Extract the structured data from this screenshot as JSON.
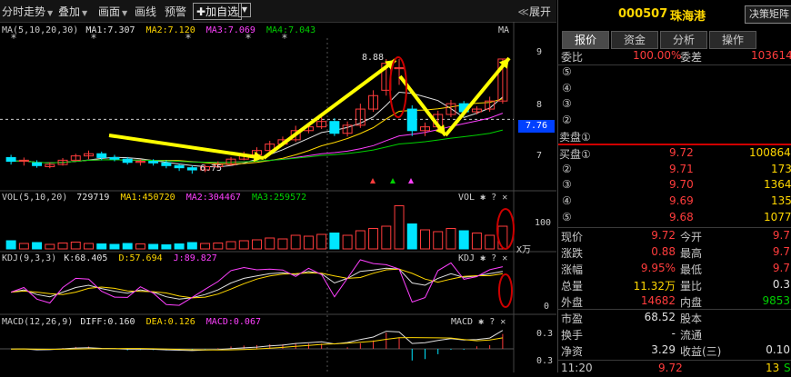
{
  "toolbar": {
    "items": [
      "分时走势",
      "叠加",
      "画面",
      "画线",
      "预警"
    ],
    "add_watch": "加自选",
    "expand": "展开"
  },
  "chart": {
    "ma_legend": {
      "label": "MA(5,10,20,30)",
      "ma1": "MA1:7.307",
      "ma2": "MA2:7.120",
      "ma3": "MA3:7.069",
      "ma4": "MA4:7.043",
      "tag": "MA"
    },
    "vol_legend": {
      "label": "VOL(5,10,20)",
      "value": "729719",
      "ma1": "MA1:450720",
      "ma2": "MA2:304467",
      "ma3": "MA3:259572",
      "tag": "VOL"
    },
    "kdj_legend": {
      "label": "KDJ(9,3,3)",
      "k": "K:68.405",
      "d": "D:57.694",
      "j": "J:89.827",
      "tag": "KDJ"
    },
    "macd_legend": {
      "label": "MACD(12,26,9)",
      "diff": "DIFF:0.160",
      "dea": "DEA:0.126",
      "macd": "MACD:0.067",
      "tag": "MACD"
    },
    "annotations": {
      "high": "8.88",
      "low": "6.75",
      "current": "7.76"
    },
    "price_axis": [
      "9",
      "8",
      "7"
    ],
    "vol_axis": [
      "100",
      "X万"
    ],
    "kdj_axis": [
      "0"
    ],
    "macd_axis": [
      "0.3",
      "0.3"
    ],
    "colors": {
      "up": "#ff3c3c",
      "down": "#00e5ff",
      "ma1": "#e0e0e0",
      "ma2": "#ffd700",
      "ma3": "#ff40ff",
      "ma4": "#00d000",
      "arrow": "#ffff00",
      "circle": "#cc0000"
    }
  },
  "chart_data": {
    "type": "candlestick",
    "price_range": [
      6.5,
      9.2
    ],
    "candles": [
      {
        "o": 7.05,
        "c": 6.98,
        "h": 7.1,
        "l": 6.92
      },
      {
        "o": 6.98,
        "c": 7.0,
        "h": 7.05,
        "l": 6.9
      },
      {
        "o": 6.95,
        "c": 6.9,
        "h": 7.0,
        "l": 6.86
      },
      {
        "o": 6.88,
        "c": 6.92,
        "h": 6.96,
        "l": 6.85
      },
      {
        "o": 6.92,
        "c": 7.0,
        "h": 7.04,
        "l": 6.9
      },
      {
        "o": 7.0,
        "c": 7.08,
        "h": 7.12,
        "l": 6.98
      },
      {
        "o": 7.08,
        "c": 7.12,
        "h": 7.18,
        "l": 7.02
      },
      {
        "o": 7.12,
        "c": 7.05,
        "h": 7.16,
        "l": 7.0
      },
      {
        "o": 7.05,
        "c": 7.02,
        "h": 7.1,
        "l": 6.98
      },
      {
        "o": 7.02,
        "c": 6.96,
        "h": 7.06,
        "l": 6.92
      },
      {
        "o": 6.96,
        "c": 6.98,
        "h": 7.02,
        "l": 6.9
      },
      {
        "o": 6.98,
        "c": 6.95,
        "h": 7.02,
        "l": 6.9
      },
      {
        "o": 6.95,
        "c": 6.9,
        "h": 7.0,
        "l": 6.85
      },
      {
        "o": 6.9,
        "c": 6.86,
        "h": 6.94,
        "l": 6.8
      },
      {
        "o": 6.86,
        "c": 6.82,
        "h": 6.9,
        "l": 6.75
      },
      {
        "o": 6.82,
        "c": 6.88,
        "h": 6.92,
        "l": 6.78
      },
      {
        "o": 6.88,
        "c": 6.92,
        "h": 6.98,
        "l": 6.85
      },
      {
        "o": 6.92,
        "c": 7.02,
        "h": 7.06,
        "l": 6.9
      },
      {
        "o": 7.02,
        "c": 7.1,
        "h": 7.16,
        "l": 7.0
      },
      {
        "o": 7.1,
        "c": 7.18,
        "h": 7.24,
        "l": 7.06
      },
      {
        "o": 7.18,
        "c": 7.3,
        "h": 7.36,
        "l": 7.15
      },
      {
        "o": 7.3,
        "c": 7.38,
        "h": 7.44,
        "l": 7.26
      },
      {
        "o": 7.38,
        "c": 7.55,
        "h": 7.64,
        "l": 7.34
      },
      {
        "o": 7.55,
        "c": 7.62,
        "h": 7.7,
        "l": 7.5
      },
      {
        "o": 7.62,
        "c": 7.72,
        "h": 7.8,
        "l": 7.58
      },
      {
        "o": 7.72,
        "c": 7.5,
        "h": 7.78,
        "l": 7.45
      },
      {
        "o": 7.5,
        "c": 7.65,
        "h": 7.72,
        "l": 7.44
      },
      {
        "o": 7.65,
        "c": 7.95,
        "h": 8.05,
        "l": 7.6
      },
      {
        "o": 7.95,
        "c": 8.2,
        "h": 8.3,
        "l": 7.9
      },
      {
        "o": 8.3,
        "c": 8.8,
        "h": 8.88,
        "l": 8.2
      },
      {
        "o": 8.7,
        "c": 8.72,
        "h": 8.88,
        "l": 8.4
      },
      {
        "o": 7.95,
        "c": 7.55,
        "h": 8.02,
        "l": 7.45
      },
      {
        "o": 7.55,
        "c": 7.62,
        "h": 7.7,
        "l": 7.45
      },
      {
        "o": 7.62,
        "c": 7.85,
        "h": 7.92,
        "l": 7.58
      },
      {
        "o": 7.85,
        "c": 8.05,
        "h": 8.12,
        "l": 7.8
      },
      {
        "o": 8.05,
        "c": 7.9,
        "h": 8.1,
        "l": 7.82
      },
      {
        "o": 7.9,
        "c": 7.95,
        "h": 8.0,
        "l": 7.85
      },
      {
        "o": 7.95,
        "c": 8.1,
        "h": 8.18,
        "l": 7.9
      },
      {
        "o": 8.1,
        "c": 8.88,
        "h": 8.88,
        "l": 8.05
      }
    ],
    "volume": [
      18,
      12,
      14,
      10,
      13,
      15,
      12,
      11,
      10,
      12,
      11,
      10,
      9,
      11,
      14,
      12,
      13,
      16,
      18,
      20,
      24,
      22,
      30,
      28,
      32,
      35,
      30,
      40,
      45,
      50,
      95,
      55,
      42,
      38,
      45,
      40,
      35,
      30,
      50
    ]
  },
  "quote": {
    "code": "000507",
    "name": "珠海港",
    "decision_button": "决策矩阵",
    "tabs": [
      "报价",
      "资金",
      "分析",
      "操作"
    ],
    "weibi_label": "委比",
    "weibi_value": "100.00%",
    "weicha_label": "委差",
    "weicha_value": "103614",
    "sell": [
      {
        "label": "⑤"
      },
      {
        "label": "④"
      },
      {
        "label": "③"
      },
      {
        "label": "②"
      },
      {
        "label": "卖盘①"
      }
    ],
    "buy": [
      {
        "label": "买盘①",
        "price": "9.72",
        "vol": "100864"
      },
      {
        "label": "②",
        "price": "9.71",
        "vol": "173"
      },
      {
        "label": "③",
        "price": "9.70",
        "vol": "1364"
      },
      {
        "label": "④",
        "price": "9.69",
        "vol": "135"
      },
      {
        "label": "⑤",
        "price": "9.68",
        "vol": "1077"
      }
    ],
    "stats": [
      {
        "l1": "现价",
        "v1": "9.72",
        "c1": "red",
        "l2": "今开",
        "v2": "9.7",
        "c2": "red"
      },
      {
        "l1": "涨跌",
        "v1": "0.88",
        "c1": "red",
        "l2": "最高",
        "v2": "9.7",
        "c2": "red"
      },
      {
        "l1": "涨幅",
        "v1": "9.95%",
        "c1": "red",
        "l2": "最低",
        "v2": "9.7",
        "c2": "red"
      },
      {
        "l1": "总量",
        "v1": "11.32万",
        "c1": "yellow",
        "l2": "量比",
        "v2": "0.3",
        "c2": "white"
      },
      {
        "l1": "外盘",
        "v1": "14682",
        "c1": "red",
        "l2": "内盘",
        "v2": "9853",
        "c2": "green"
      }
    ],
    "stats2": [
      {
        "l1": "市盈",
        "v1": "68.52",
        "c1": "white",
        "l2": "股本",
        "v2": "",
        "c2": "white"
      },
      {
        "l1": "换手",
        "v1": "-",
        "c1": "white",
        "l2": "流通",
        "v2": "",
        "c2": "white"
      },
      {
        "l1": "净资",
        "v1": "3.29",
        "c1": "white",
        "l2": "收益(三)",
        "v2": "0.10",
        "c2": "white"
      }
    ],
    "tick": {
      "time": "11:20",
      "price": "9.72",
      "vol": "13",
      "flag": "S"
    }
  }
}
